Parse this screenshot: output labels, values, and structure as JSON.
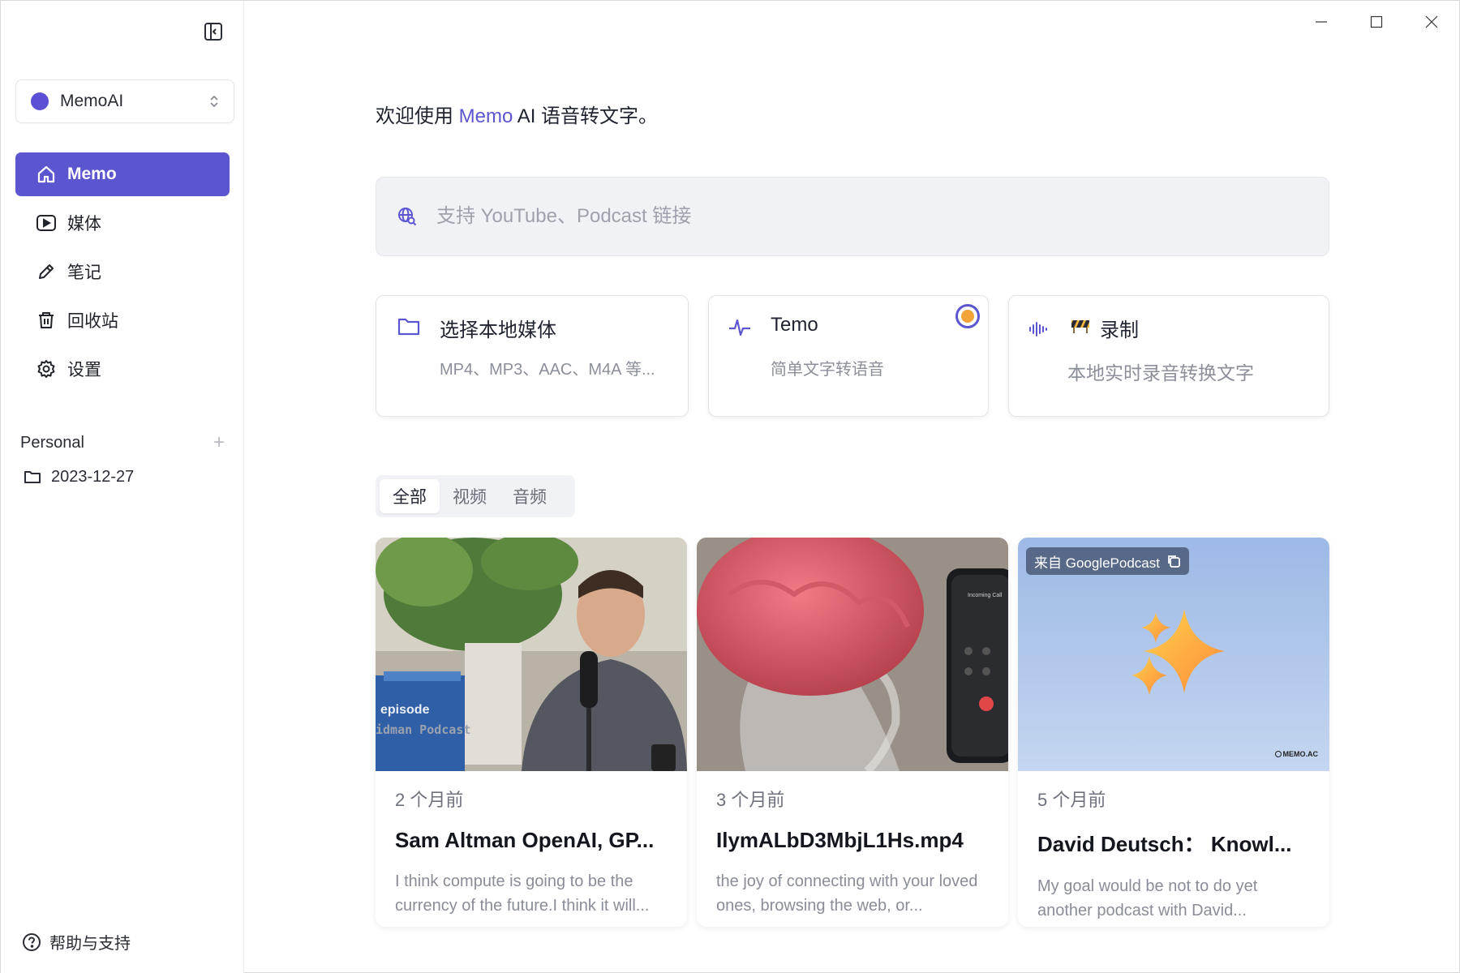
{
  "sidebar": {
    "workspace": {
      "name": "MemoAI",
      "color": "#5b4fd6"
    },
    "nav": [
      {
        "label": "Memo",
        "icon": "home-icon",
        "active": true
      },
      {
        "label": "媒体",
        "icon": "play-icon"
      },
      {
        "label": "笔记",
        "icon": "pencil-icon"
      },
      {
        "label": "回收站",
        "icon": "trash-icon"
      },
      {
        "label": "设置",
        "icon": "gear-icon"
      }
    ],
    "section": {
      "title": "Personal",
      "add": "+"
    },
    "folders": [
      {
        "label": "2023-12-27",
        "icon": "folder-icon"
      }
    ],
    "help": {
      "label": "帮助与支持"
    }
  },
  "main": {
    "welcome": {
      "prefix": "欢迎使用 ",
      "accent": "Memo",
      "suffix": " AI 语音转文字。"
    },
    "link_input": {
      "placeholder": "支持 YouTube、Podcast 链接"
    },
    "actions": [
      {
        "title": "选择本地媒体",
        "subtitle": "MP4、MP3、AAC、M4A 等..."
      },
      {
        "title": "Temo",
        "subtitle": "简单文字转语音"
      },
      {
        "title": "录制",
        "subtitle": "本地实时录音转换文字"
      }
    ],
    "tabs": [
      {
        "label": "全部",
        "active": true
      },
      {
        "label": "视频"
      },
      {
        "label": "音频"
      }
    ],
    "media": [
      {
        "time": "2 个月前",
        "title": "Sam Altman OpenAI, GP...",
        "desc": "I think compute is going to be the currency of the future.I think it will...",
        "overlay1": "episode",
        "overlay2": "idman Podcast"
      },
      {
        "time": "3 个月前",
        "title": "IlymALbD3MbjL1Hs.mp4",
        "desc": "the joy of connecting with your loved ones, browsing the web, or...",
        "phone_text": "Incoming Call"
      },
      {
        "time": "5 个月前",
        "title": "David Deutsch： Knowl...",
        "desc": "My goal would be not to do yet another podcast with David...",
        "source": "来自 GooglePodcast",
        "watermark": "MEMO.AC"
      }
    ]
  },
  "colors": {
    "accent": "#5b56cf",
    "record_dot": "#f2a43a"
  }
}
